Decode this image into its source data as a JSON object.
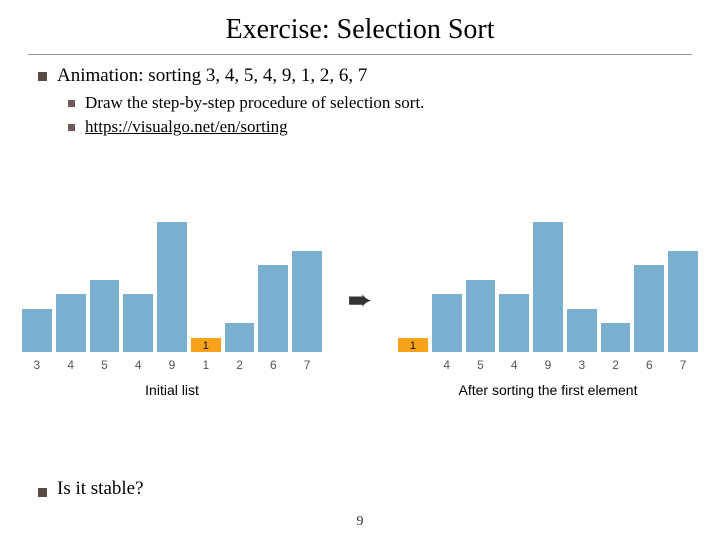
{
  "title": "Exercise: Selection Sort",
  "bullets": {
    "animation": "Animation: sorting 3, 4, 5, 4, 9, 1, 2, 6, 7",
    "draw": "Draw the step-by-step procedure of selection sort.",
    "link": "https://visualgo.net/en/sorting"
  },
  "arrow_glyph": "➨",
  "captions": {
    "left": "Initial list",
    "right": "After sorting the first element"
  },
  "question": "Is it stable?",
  "page": "9",
  "chart_data": [
    {
      "type": "bar",
      "categories": [
        "3",
        "4",
        "5",
        "4",
        "9",
        "1",
        "2",
        "6",
        "7"
      ],
      "values": [
        3,
        4,
        5,
        4,
        9,
        1,
        2,
        6,
        7
      ],
      "highlight_index": 5,
      "highlight_label": "1",
      "ylim": [
        0,
        9
      ],
      "title": "Initial list"
    },
    {
      "type": "bar",
      "categories": [
        "",
        "4",
        "5",
        "4",
        "9",
        "3",
        "2",
        "6",
        "7"
      ],
      "values": [
        1,
        4,
        5,
        4,
        9,
        3,
        2,
        6,
        7
      ],
      "highlight_index": 0,
      "highlight_label": "1",
      "ylim": [
        0,
        9
      ],
      "title": "After sorting the first element"
    }
  ]
}
